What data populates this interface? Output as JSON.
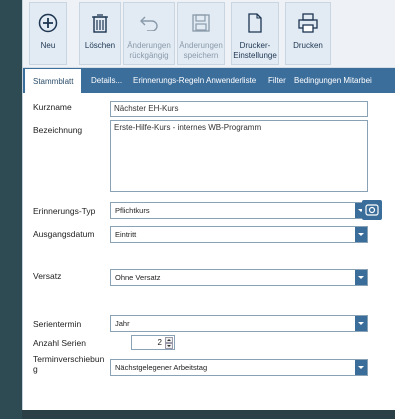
{
  "toolbar": {
    "new_label": "Neu",
    "delete_label": "Löschen",
    "undo_label": "Änderungen rückgängig",
    "save_label": "Änderungen speichern",
    "printer_label": "Drucker-Einstellunge",
    "print_label": "Drucken"
  },
  "tabs": [
    "Stammblatt",
    "Details...",
    "Erinnerungs-Regeln",
    "Anwenderliste",
    "Filter",
    "Bedingungen Mitarbei"
  ],
  "form": {
    "kurzname_label": "Kurzname",
    "kurzname_value": "Nächster EH-Kurs",
    "bezeichnung_label": "Bezeichnung",
    "bezeichnung_value": "Erste-Hilfe-Kurs - internes WB-Programm",
    "erinnerungstyp_label": "Erinnerungs-Typ",
    "erinnerungstyp_value": "Pflichtkurs",
    "ausgangsdatum_label": "Ausgangsdatum",
    "ausgangsdatum_value": "Eintritt",
    "versatz_label": "Versatz",
    "versatz_value": "Ohne Versatz",
    "serientermin_label": "Serientermin",
    "serientermin_value": "Jahr",
    "anzahl_label": "Anzahl Serien",
    "anzahl_value": "2",
    "terminverschiebung_label": "Terminverschiebun g",
    "terminverschiebung_value": "Nächstgelegener Arbeitstag"
  },
  "colors": {
    "accent": "#3c6e9c",
    "background": "#2e4a52"
  }
}
